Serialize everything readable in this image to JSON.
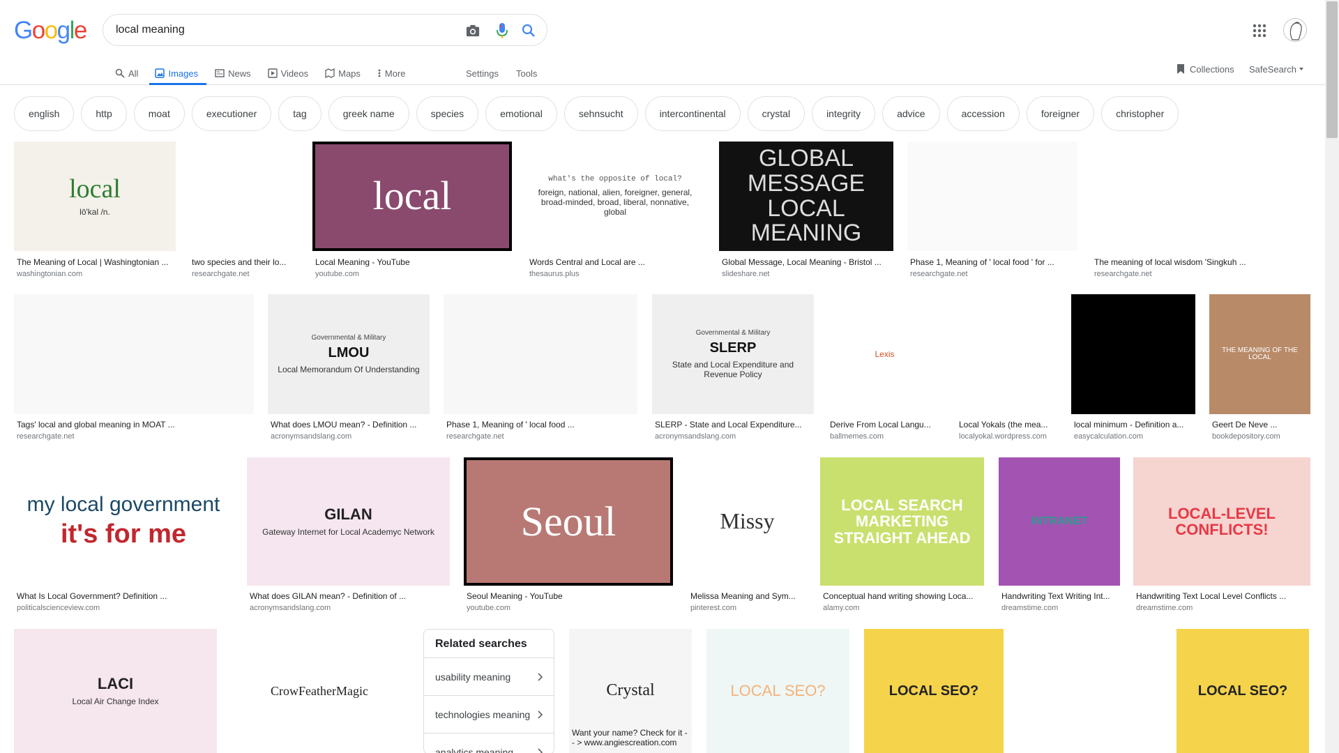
{
  "search": {
    "query": "local meaning",
    "logo_letters": [
      "G",
      "o",
      "o",
      "g",
      "l",
      "e"
    ],
    "logo_colors": [
      "#4285f4",
      "#ea4335",
      "#fbbc05",
      "#4285f4",
      "#34a853",
      "#ea4335"
    ]
  },
  "tabs": [
    {
      "label": "All",
      "icon": "search-icon"
    },
    {
      "label": "Images",
      "icon": "image-icon",
      "active": true
    },
    {
      "label": "News",
      "icon": "news-icon"
    },
    {
      "label": "Videos",
      "icon": "video-icon"
    },
    {
      "label": "Maps",
      "icon": "map-icon"
    },
    {
      "label": "More",
      "icon": "more-vert-icon"
    }
  ],
  "tools": {
    "settings": "Settings",
    "tools": "Tools"
  },
  "right": {
    "collections": "Collections",
    "safesearch": "SafeSearch"
  },
  "chips": [
    "english",
    "http",
    "moat",
    "executioner",
    "tag",
    "greek name",
    "species",
    "emotional",
    "sehnsucht",
    "intercontinental",
    "crystal",
    "integrity",
    "advice",
    "accession",
    "foreigner",
    "christopher"
  ],
  "results": {
    "row1": [
      {
        "caption": "The Meaning of Local | Washingtonian ...",
        "source": "washingtonian.com",
        "thumb_text": "local",
        "thumb_sub": "lō'kal /n."
      },
      {
        "caption": "two species and their lo...",
        "source": "researchgate.net"
      },
      {
        "caption": "Local Meaning - YouTube",
        "source": "youtube.com",
        "thumb_text": "local"
      },
      {
        "caption": "Words Central and Local are ...",
        "source": "thesaurus.plus",
        "thumb_text": "what's the opposite of local?",
        "thumb_sub": "foreign, national, alien, foreigner, general, broad-minded, broad, liberal, nonnative, global"
      },
      {
        "caption": "Global Message, Local Meaning - Bristol ...",
        "source": "slideshare.net",
        "thumb_text": "GLOBAL MESSAGE LOCAL MEANING"
      },
      {
        "caption": "Phase 1, Meaning of ' local food ' for ...",
        "source": "researchgate.net"
      },
      {
        "caption": "The meaning of local wisdom 'Singkuh ...",
        "source": "researchgate.net"
      }
    ],
    "row2": [
      {
        "caption": "Tags' local and global meaning in MOAT ...",
        "source": "researchgate.net"
      },
      {
        "caption": "What does LMOU mean? - Definition ...",
        "source": "acronymsandslang.com",
        "thumb_text": "LMOU",
        "thumb_sub": "Local Memorandum Of Understanding",
        "thumb_top": "Governmental & Military"
      },
      {
        "caption": "Phase 1, Meaning of ' local food ...",
        "source": "researchgate.net"
      },
      {
        "caption": "SLERP - State and Local Expenditure...",
        "source": "acronymsandslang.com",
        "thumb_text": "SLERP",
        "thumb_sub": "State and Local Expenditure and Revenue Policy",
        "thumb_top": "Governmental & Military"
      },
      {
        "caption": "Derive From Local Langu...",
        "source": "ballmemes.com",
        "thumb_text": "Lexis"
      },
      {
        "caption": "Local Yokals (the mea...",
        "source": "localyokal.wordpress.com"
      },
      {
        "caption": "local minimum - Definition a...",
        "source": "easycalculation.com"
      },
      {
        "caption": "Geert De Neve ...",
        "source": "bookdepository.com",
        "thumb_text": "THE MEANING OF THE LOCAL"
      }
    ],
    "row3": [
      {
        "caption": "What Is Local Government? Definition ...",
        "source": "politicalscienceview.com",
        "thumb_text": "my local government",
        "thumb_sub": "it's for me"
      },
      {
        "caption": "What does GILAN mean? - Definition of ...",
        "source": "acronymsandslang.com",
        "thumb_text": "GILAN",
        "thumb_sub": "Gateway Internet for Local Academyc Network"
      },
      {
        "caption": "Seoul Meaning - YouTube",
        "source": "youtube.com",
        "thumb_text": "Seoul"
      },
      {
        "caption": "Melissa Meaning and Sym...",
        "source": "pinterest.com",
        "thumb_text": "Missy"
      },
      {
        "caption": "Conceptual hand writing showing Loca...",
        "source": "alamy.com",
        "thumb_text": "LOCAL SEARCH MARKETING STRAIGHT AHEAD"
      },
      {
        "caption": "Handwriting Text Writing Int...",
        "source": "dreamstime.com",
        "thumb_text": "INTRANET"
      },
      {
        "caption": "Handwriting Text Local Level Conflicts ...",
        "source": "dreamstime.com",
        "thumb_text": "LOCAL-LEVEL CONFLICTS!"
      }
    ],
    "row4": [
      {
        "thumb_text": "LACI",
        "thumb_sub": "Local Air Change Index"
      },
      {
        "thumb_text": "CrowFeatherMagic"
      },
      {
        "thumb_text": "Crystal",
        "caption": "Want your name? Check for it -- > www.angiescreation.com"
      },
      {
        "thumb_text": "LOCAL SEO?"
      },
      {
        "thumb_text": "LOCAL SEO?"
      },
      {
        "thumb_text": ""
      },
      {
        "thumb_text": "LOCAL SEO?"
      }
    ]
  },
  "related": {
    "title": "Related searches",
    "items": [
      "usability meaning",
      "technologies meaning",
      "analytics meaning"
    ]
  }
}
